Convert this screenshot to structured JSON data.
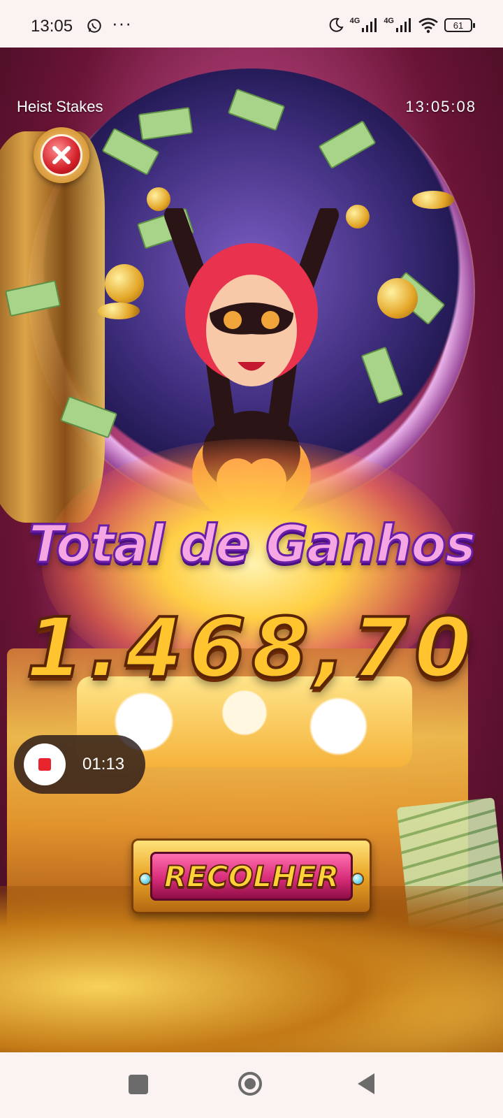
{
  "status_bar": {
    "time": "13:05",
    "whatsapp_icon": "whatsapp-icon",
    "more_dots": "···",
    "network_label_1": "4G",
    "network_label_2": "4G",
    "battery_level": "61"
  },
  "game": {
    "title": "Heist Stakes",
    "clock": "13:05:08",
    "close_icon": "close-icon",
    "win_label": "Total de Ganhos",
    "win_amount": "1.468,70",
    "collect_button": "RECOLHER"
  },
  "screen_recorder": {
    "elapsed": "01:13",
    "stop_icon": "stop-icon"
  },
  "nav_bar": {
    "recents_icon": "recents-square-icon",
    "home_icon": "home-circle-icon",
    "back_icon": "back-triangle-icon"
  },
  "colors": {
    "status_bar_bg": "#fbf3f2",
    "win_label_fill": "#f7a6e4",
    "win_amount_fill": "#ffc42e",
    "collect_button_face": "#d82d7a",
    "record_stop": "#e8242e"
  }
}
